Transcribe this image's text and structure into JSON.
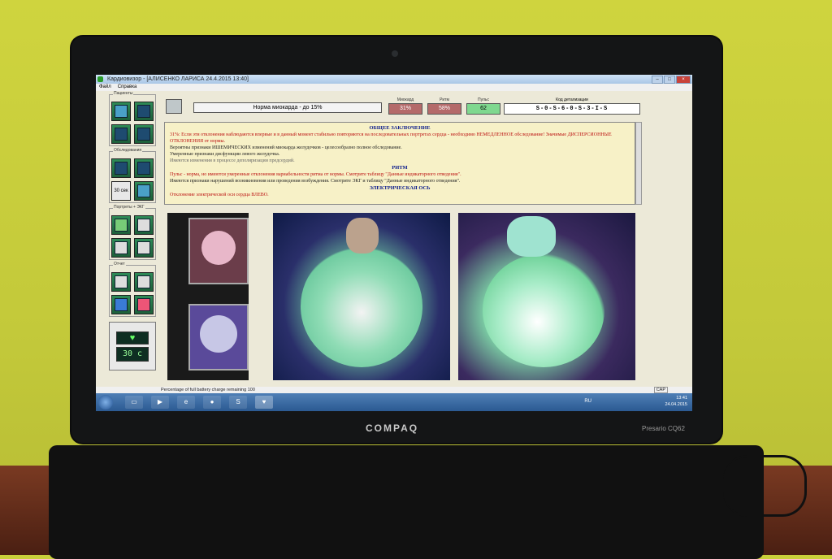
{
  "window": {
    "title": "Кардиовизор - [АЛИСЕНКО  ЛАРИСА    24.4.2015  13:40]",
    "menu": [
      "Файл",
      "Справка"
    ]
  },
  "sidebar": {
    "groups": [
      {
        "title": "Пациенты"
      },
      {
        "title": "Обследования",
        "timer_label": "30 сек"
      },
      {
        "title": "Портреты + ЭКГ"
      },
      {
        "title": "Отчет"
      }
    ],
    "status_timer": "30 с"
  },
  "topbar": {
    "norm_text": "Норма миокарда - до 15%",
    "metrics": [
      {
        "label": "Миокард",
        "value": "31%",
        "color": "#b46a6a"
      },
      {
        "label": "Ритм",
        "value": "58%",
        "color": "#b46a6a"
      },
      {
        "label": "Пульс",
        "value": "62",
        "color": "#66c27a"
      }
    ],
    "code_label": "Код детализации",
    "code_value": "S-0-S-6-0-S-3-I-S"
  },
  "conclusion": {
    "heading1": "ОБЩЕЕ ЗАКЛЮЧЕНИЕ",
    "line1": "31%:   Если эти отклонения наблюдаются впервые и в данный момент стабильно повторяются на последовательных портретах сердца - необходимо НЕМЕДЛЕННОЕ обследование!    Значимые ДИСПЕРСИОННЫЕ ОТКЛОНЕНИЯ от нормы.",
    "line2": "Вероятны признаки ИШЕМИЧЕСКИХ изменений миокарда желудочков - целесообразно полное обследование.",
    "line3": "Умеренные признаки дисфункции левого желудочка.",
    "line4": "Имеются изменения в процессе деполяризации предсердий.",
    "heading2": "РИТМ",
    "line5": "Пульс - норма, но имеются умеренные отклонения вариабельности ритма от нормы. Смотрите таблицу \"Данные индикаторного отведения\".",
    "line6": "Имеются признаки нарушений возникновения или проведения возбуждения. Смотрите ЭКГ и таблицу \"Данные индикаторного отведения\".",
    "heading3": "ЭЛЕКТРИЧЕСКАЯ ОСЬ",
    "line7": "Отклонение электрической оси сердца ВЛЕВО."
  },
  "statusbar": {
    "battery_text": "Percentage of full battery charge remaining 100",
    "cap": "CAP"
  },
  "taskbar": {
    "lang": "RU",
    "time": "13:41",
    "date": "24.04.2015",
    "items": [
      "folder-icon",
      "media-player-icon",
      "ie-icon",
      "hp-icon",
      "skype-icon",
      "cardiovisor-icon"
    ]
  },
  "laptop": {
    "brand": "COMPAQ",
    "model": "Presario CQ62"
  }
}
